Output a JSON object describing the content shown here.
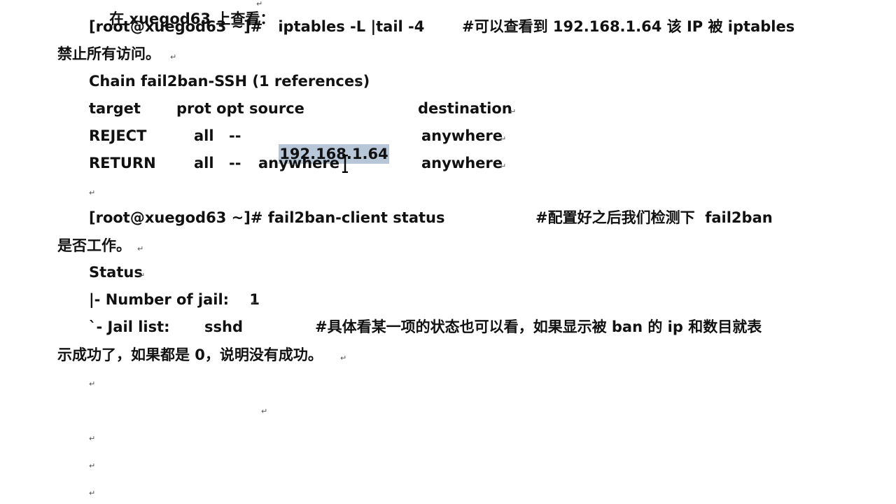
{
  "document": {
    "line_top_cut": "在 xuegod63 上查看：",
    "cmd1": "[root@xuegod63 ~]#   iptables -L |tail -4",
    "cmd1_comment": "#可以查看到 192.168.1.64 该 IP 被 iptables",
    "cmd1_wrap": "禁止所有访问。",
    "chain": "Chain fail2ban-SSH (1 references)",
    "header_target": "target",
    "header_prot_opt_source": "prot opt source",
    "header_destination": "destination",
    "row1_target": "REJECT",
    "row1_prot": "all",
    "row1_opt": "--",
    "row1_source": "192.168.1.64",
    "row1_dest": "anywhere",
    "row2_target": "RETURN",
    "row2_prot": "all",
    "row2_opt": "--",
    "row2_source": "anywhere",
    "row2_dest": "anywhere",
    "cmd2": "[root@xuegod63 ~]# fail2ban-client status",
    "cmd2_comment": "#配置好之后我们检测下  fail2ban",
    "cmd2_wrap": "是否工作。",
    "status": "Status",
    "jail_count": "|- Number of jail:    1",
    "jail_list_label": "`- Jail list:",
    "jail_list_value": "sshd",
    "jail_comment": "#具体看某一项的状态也可以看，如果显示被 ban 的 ip 和数目就表",
    "jail_comment_wrap": "示成功了，如果都是 0，说明没有成功。",
    "paragraph_mark": "↵"
  },
  "colors": {
    "text": "#111111",
    "selection": "#b8c7d8",
    "background": "#ffffff"
  }
}
